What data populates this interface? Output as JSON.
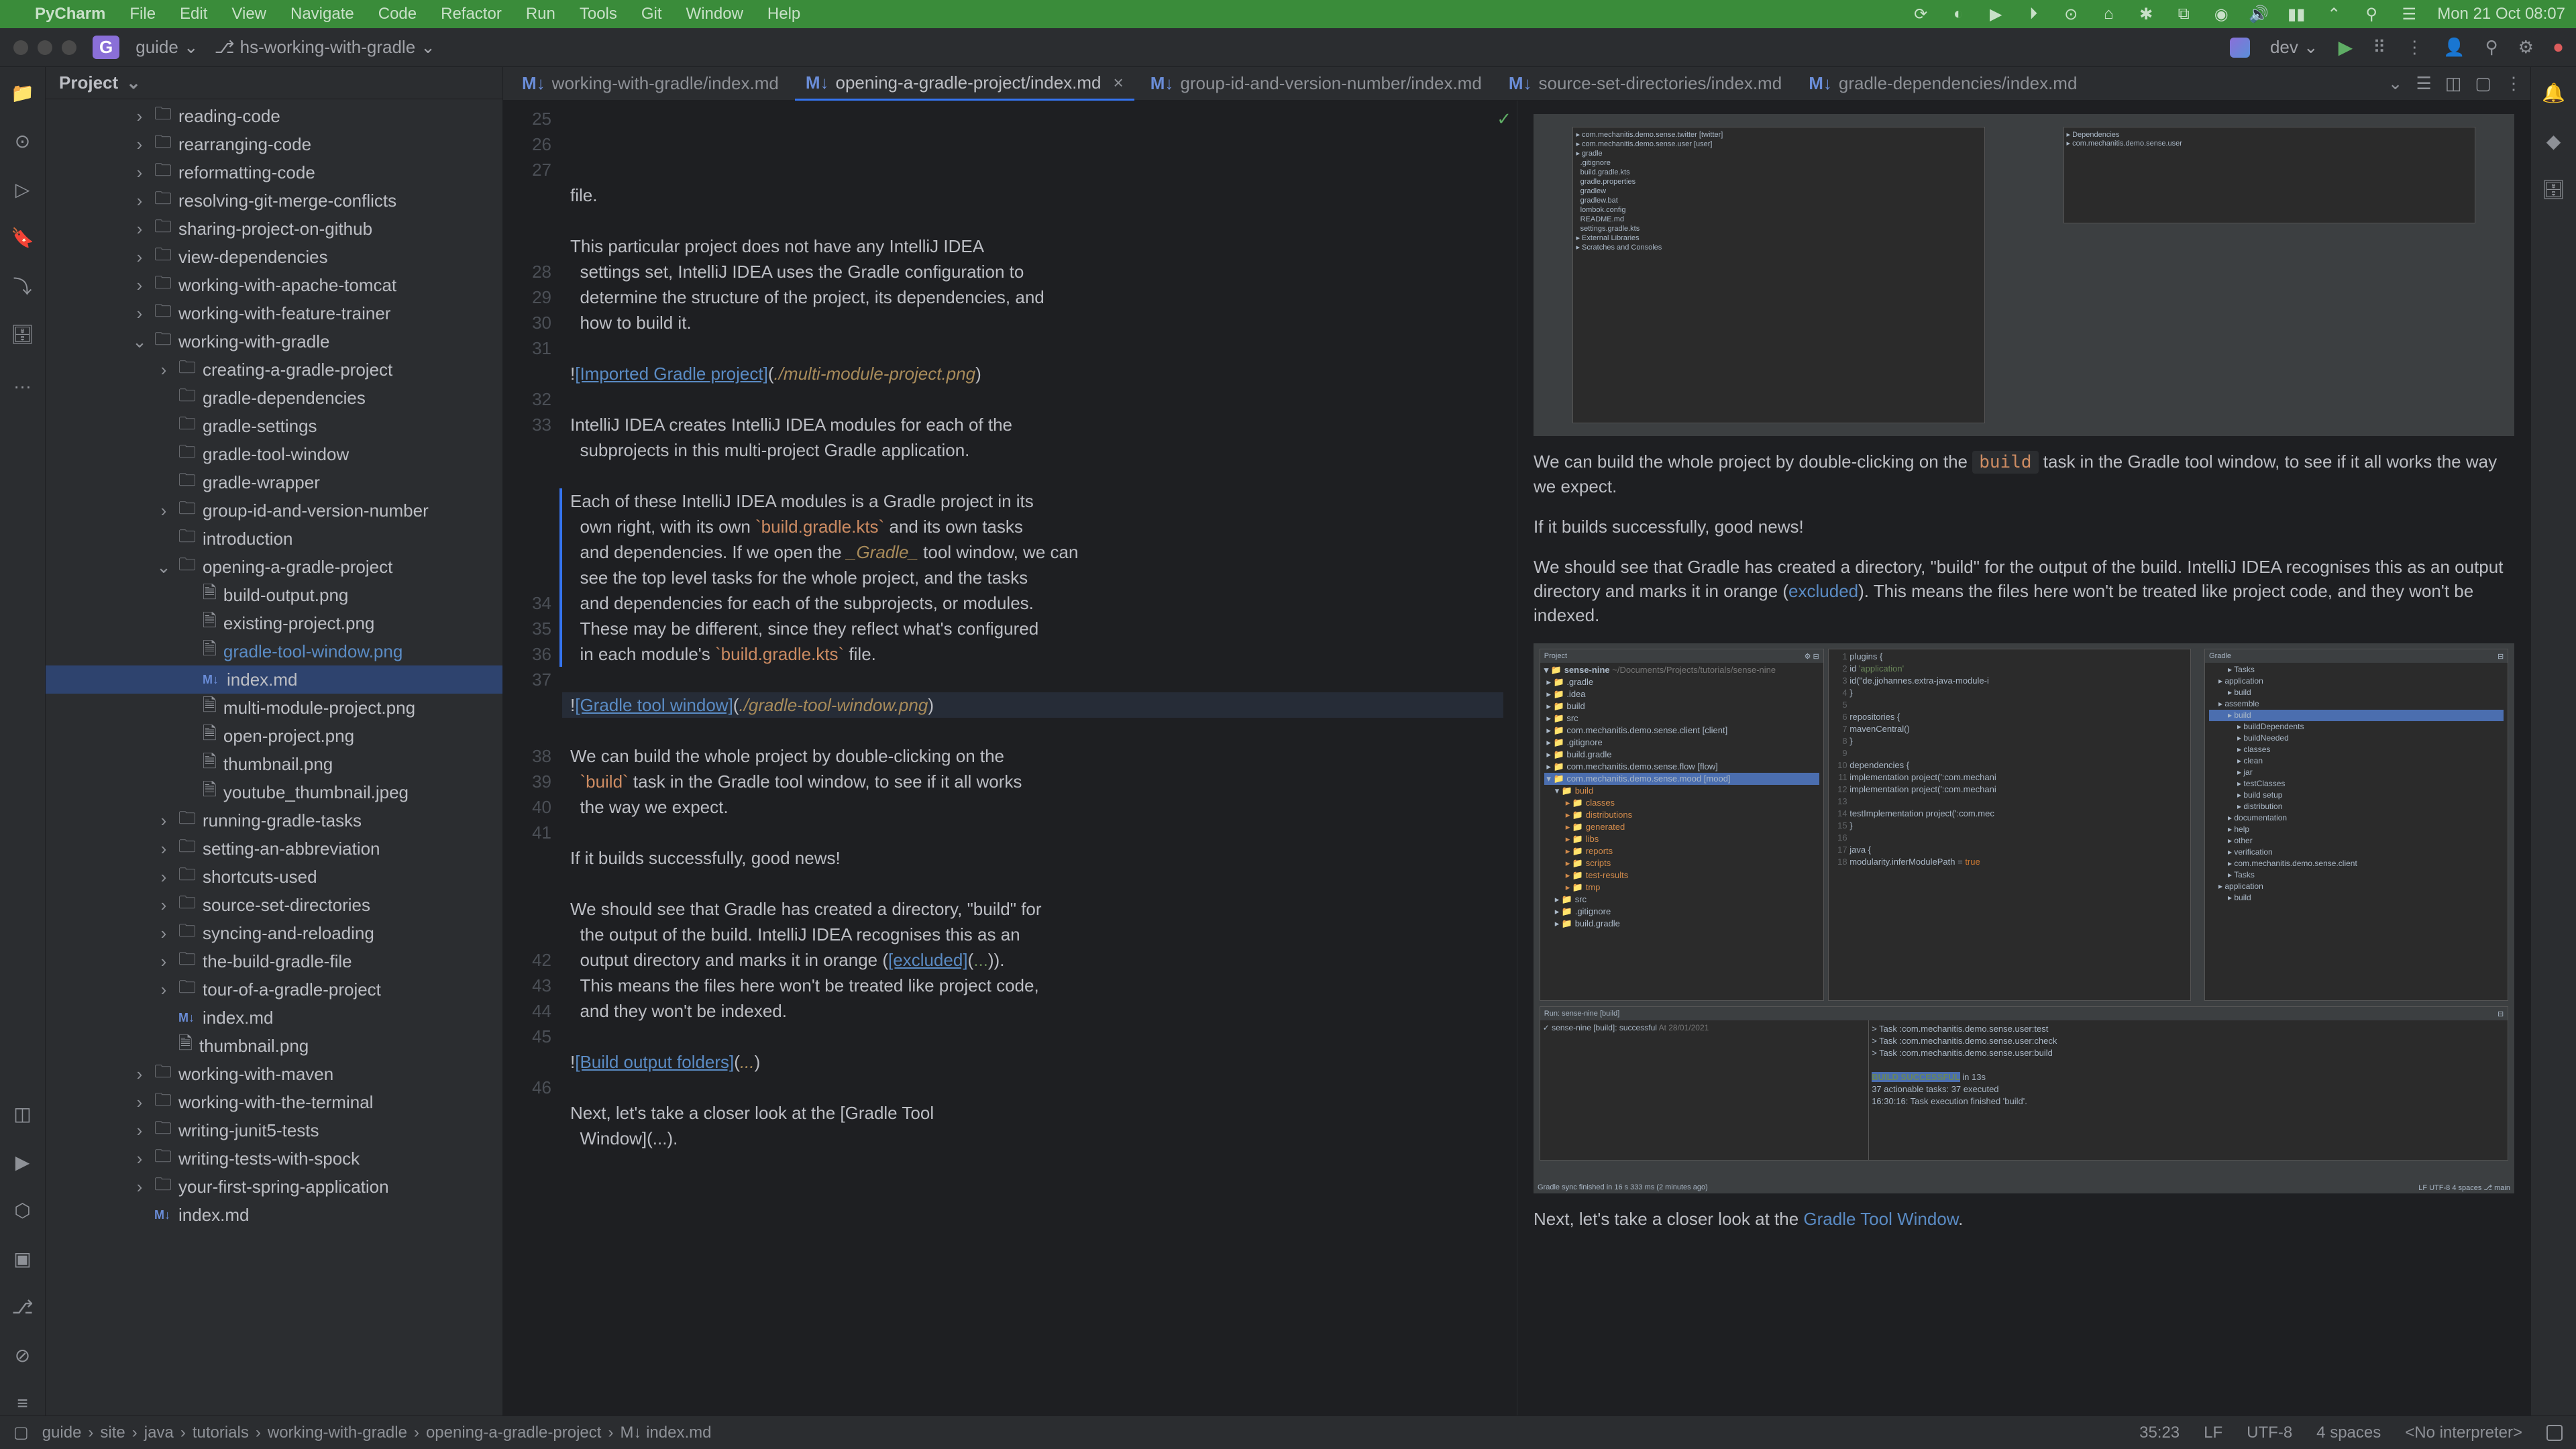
{
  "menubar": {
    "app": "PyCharm",
    "items": [
      "File",
      "Edit",
      "View",
      "Navigate",
      "Code",
      "Refactor",
      "Run",
      "Tools",
      "Git",
      "Window",
      "Help"
    ],
    "clock": "Mon 21 Oct 08:07"
  },
  "titlebar": {
    "project_badge": "G",
    "project_name": "guide",
    "branch_prefix": "⎇",
    "branch": "hs-working-with-gradle",
    "run_config": "dev"
  },
  "project_panel": {
    "title": "Project",
    "tree": [
      {
        "depth": 3,
        "arrow": ">",
        "icon": "folder",
        "label": "reading-code"
      },
      {
        "depth": 3,
        "arrow": ">",
        "icon": "folder",
        "label": "rearranging-code"
      },
      {
        "depth": 3,
        "arrow": ">",
        "icon": "folder",
        "label": "reformatting-code"
      },
      {
        "depth": 3,
        "arrow": ">",
        "icon": "folder",
        "label": "resolving-git-merge-conflicts"
      },
      {
        "depth": 3,
        "arrow": ">",
        "icon": "folder",
        "label": "sharing-project-on-github"
      },
      {
        "depth": 3,
        "arrow": ">",
        "icon": "folder",
        "label": "view-dependencies"
      },
      {
        "depth": 3,
        "arrow": ">",
        "icon": "folder",
        "label": "working-with-apache-tomcat"
      },
      {
        "depth": 3,
        "arrow": ">",
        "icon": "folder",
        "label": "working-with-feature-trainer"
      },
      {
        "depth": 3,
        "arrow": "v",
        "icon": "folder",
        "label": "working-with-gradle"
      },
      {
        "depth": 4,
        "arrow": ">",
        "icon": "folder",
        "label": "creating-a-gradle-project"
      },
      {
        "depth": 4,
        "arrow": "",
        "icon": "folder",
        "label": "gradle-dependencies"
      },
      {
        "depth": 4,
        "arrow": "",
        "icon": "folder",
        "label": "gradle-settings"
      },
      {
        "depth": 4,
        "arrow": "",
        "icon": "folder",
        "label": "gradle-tool-window"
      },
      {
        "depth": 4,
        "arrow": "",
        "icon": "folder",
        "label": "gradle-wrapper"
      },
      {
        "depth": 4,
        "arrow": ">",
        "icon": "folder",
        "label": "group-id-and-version-number"
      },
      {
        "depth": 4,
        "arrow": "",
        "icon": "folder",
        "label": "introduction"
      },
      {
        "depth": 4,
        "arrow": "v",
        "icon": "folder",
        "label": "opening-a-gradle-project"
      },
      {
        "depth": 5,
        "arrow": "",
        "icon": "file",
        "label": "build-output.png"
      },
      {
        "depth": 5,
        "arrow": "",
        "icon": "file",
        "label": "existing-project.png"
      },
      {
        "depth": 5,
        "arrow": "",
        "icon": "file",
        "label": "gradle-tool-window.png",
        "hl": true
      },
      {
        "depth": 5,
        "arrow": "",
        "icon": "md",
        "label": "index.md",
        "selected": true
      },
      {
        "depth": 5,
        "arrow": "",
        "icon": "file",
        "label": "multi-module-project.png"
      },
      {
        "depth": 5,
        "arrow": "",
        "icon": "file",
        "label": "open-project.png"
      },
      {
        "depth": 5,
        "arrow": "",
        "icon": "file",
        "label": "thumbnail.png"
      },
      {
        "depth": 5,
        "arrow": "",
        "icon": "file",
        "label": "youtube_thumbnail.jpeg"
      },
      {
        "depth": 4,
        "arrow": ">",
        "icon": "folder",
        "label": "running-gradle-tasks"
      },
      {
        "depth": 4,
        "arrow": ">",
        "icon": "folder",
        "label": "setting-an-abbreviation"
      },
      {
        "depth": 4,
        "arrow": ">",
        "icon": "folder",
        "label": "shortcuts-used"
      },
      {
        "depth": 4,
        "arrow": ">",
        "icon": "folder",
        "label": "source-set-directories"
      },
      {
        "depth": 4,
        "arrow": ">",
        "icon": "folder",
        "label": "syncing-and-reloading"
      },
      {
        "depth": 4,
        "arrow": ">",
        "icon": "folder",
        "label": "the-build-gradle-file"
      },
      {
        "depth": 4,
        "arrow": ">",
        "icon": "folder",
        "label": "tour-of-a-gradle-project"
      },
      {
        "depth": 4,
        "arrow": "",
        "icon": "md",
        "label": "index.md"
      },
      {
        "depth": 4,
        "arrow": "",
        "icon": "file",
        "label": "thumbnail.png"
      },
      {
        "depth": 3,
        "arrow": ">",
        "icon": "folder",
        "label": "working-with-maven"
      },
      {
        "depth": 3,
        "arrow": ">",
        "icon": "folder",
        "label": "working-with-the-terminal"
      },
      {
        "depth": 3,
        "arrow": ">",
        "icon": "folder",
        "label": "writing-junit5-tests"
      },
      {
        "depth": 3,
        "arrow": ">",
        "icon": "folder",
        "label": "writing-tests-with-spock"
      },
      {
        "depth": 3,
        "arrow": ">",
        "icon": "folder",
        "label": "your-first-spring-application"
      },
      {
        "depth": 3,
        "arrow": "",
        "icon": "md",
        "label": "index.md"
      }
    ]
  },
  "tabs": [
    {
      "label": "working-with-gradle/index.md",
      "active": false
    },
    {
      "label": "opening-a-gradle-project/index.md",
      "active": true
    },
    {
      "label": "group-id-and-version-number/index.md",
      "active": false
    },
    {
      "label": "source-set-directories/index.md",
      "active": false
    },
    {
      "label": "gradle-dependencies/index.md",
      "active": false
    }
  ],
  "editor": {
    "lines": [
      {
        "n": 25,
        "text": "  file."
      },
      {
        "n": 26,
        "text": ""
      },
      {
        "n": 27,
        "text": "This particular project does not have any IntelliJ IDEA settings set, IntelliJ IDEA uses the Gradle configuration to determine the structure of the project, its dependencies, and how to build it."
      },
      {
        "n": 28,
        "text": ""
      },
      {
        "n": 29,
        "text": "![Imported Gradle project](./multi-module-project.png)",
        "img": true
      },
      {
        "n": 30,
        "text": ""
      },
      {
        "n": 31,
        "text": "IntelliJ IDEA creates IntelliJ IDEA modules for each of the subprojects in this multi-project Gradle application."
      },
      {
        "n": 32,
        "text": ""
      },
      {
        "n": 33,
        "text": "Each of these IntelliJ IDEA modules is a Gradle project in its own right, with its own `build.gradle.kts` and its own tasks and dependencies. If we open the _Gradle_ tool window, we can see the top level tasks for the whole project, and the tasks and dependencies for each of the subprojects, or modules. These may be different, since they reflect what's configured in each module's `build.gradle.kts` file.",
        "blue": true
      },
      {
        "n": 34,
        "text": ""
      },
      {
        "n": 35,
        "text": "![Gradle tool window](./gradle-tool-window.png)",
        "img": true,
        "hl": true
      },
      {
        "n": 36,
        "text": ""
      },
      {
        "n": 37,
        "text": "We can build the whole project by double-clicking on the `build` task in the Gradle tool window, to see if it all works the way we expect."
      },
      {
        "n": 38,
        "text": ""
      },
      {
        "n": 39,
        "text": "If it builds successfully, good news!"
      },
      {
        "n": 40,
        "text": ""
      },
      {
        "n": 41,
        "text": "We should see that Gradle has created a directory, \"build\" for the output of the build. IntelliJ IDEA recognises this as an output directory and marks it in orange ([excluded](...)). This means the files here won't be treated like project code, and they won't be indexed."
      },
      {
        "n": 42,
        "text": ""
      },
      {
        "n": 43,
        "text": "![Build output folders](...)",
        "img": true
      },
      {
        "n": 44,
        "text": ""
      },
      {
        "n": 45,
        "text": "Next, let's take a closer look at the [Gradle Tool Window](...)."
      },
      {
        "n": 46,
        "text": ""
      }
    ]
  },
  "preview": {
    "p1_a": "We can build the whole project by double-clicking on the ",
    "p1_code": "build",
    "p1_b": " task in the Gradle tool window, to see if it all works the way we expect.",
    "p2": "If it builds successfully, good news!",
    "p3_a": "We should see that Gradle has created a directory, \"build\" for the output of the build. IntelliJ IDEA recognises this as an output directory and marks it in orange (",
    "p3_link": "excluded",
    "p3_b": "). This means the files here won't be treated like project code, and they won't be indexed.",
    "p4_a": "Next, let's take a closer look at the ",
    "p4_link": "Gradle Tool Window",
    "p4_b": "."
  },
  "preview_img2": {
    "project_header": "Project",
    "tree_root": "sense-nine",
    "tree_root_path": "~/Documents/Projects/tutorials/sense-nine",
    "tree": [
      ".gradle",
      ".idea",
      "build",
      "src",
      "com.mechanitis.demo.sense.client [client]",
      ".gitignore",
      "build.gradle",
      "com.mechanitis.demo.sense.flow [flow]",
      "com.mechanitis.demo.sense.mood [mood]"
    ],
    "build_children": [
      "classes",
      "distributions",
      "generated",
      "libs",
      "reports",
      "scripts",
      "test-results",
      "tmp"
    ],
    "tree_tail": [
      "src",
      ".gitignore",
      "build.gradle"
    ],
    "code_lines": [
      {
        "n": 1,
        "t": "plugins {"
      },
      {
        "n": 2,
        "t": "    id 'application'"
      },
      {
        "n": 3,
        "t": "    id(\"de.jjohannes.extra-java-module-i"
      },
      {
        "n": 4,
        "t": "}"
      },
      {
        "n": 5,
        "t": ""
      },
      {
        "n": 6,
        "t": "repositories {"
      },
      {
        "n": 7,
        "t": "    mavenCentral()"
      },
      {
        "n": 8,
        "t": "}"
      },
      {
        "n": 9,
        "t": ""
      },
      {
        "n": 10,
        "t": "dependencies {"
      },
      {
        "n": 11,
        "t": "    implementation project(':com.mechani"
      },
      {
        "n": 12,
        "t": "    implementation project(':com.mechani"
      },
      {
        "n": 13,
        "t": ""
      },
      {
        "n": 14,
        "t": "    testImplementation project(':com.mec"
      },
      {
        "n": 15,
        "t": "}"
      },
      {
        "n": 16,
        "t": ""
      },
      {
        "n": 17,
        "t": "java {"
      },
      {
        "n": 18,
        "t": "    modularity.inferModulePath = true"
      }
    ],
    "gradle_header": "Gradle",
    "gradle_tree": [
      "Tasks",
      "application",
      "build",
      "assemble",
      "build",
      "buildDependents",
      "buildNeeded",
      "classes",
      "clean",
      "jar",
      "testClasses",
      "build setup",
      "distribution",
      "documentation",
      "help",
      "other",
      "verification",
      "com.mechanitis.demo.sense.client",
      "Tasks",
      "application",
      "build"
    ],
    "run_header": "Run:",
    "run_title": "sense-nine [build]",
    "run_status": "sense-nine [build]: successful",
    "run_time": "At 28/01/2021",
    "run_output": [
      "> Task :com.mechanitis.demo.sense.user:test",
      "> Task :com.mechanitis.demo.sense.user:check",
      "> Task :com.mechanitis.demo.sense.user:build",
      "",
      "BUILD SUCCESSFUL in 13s",
      "37 actionable tasks: 37 executed",
      "16:30:16: Task execution finished 'build'."
    ],
    "bottom_status_left": "Gradle sync finished in 16 s 333 ms (2 minutes ago)",
    "bottom_status_right": "LF  UTF-8  4 spaces  ⎇ main"
  },
  "breadcrumb": [
    "guide",
    "site",
    "java",
    "tutorials",
    "working-with-gradle",
    "opening-a-gradle-project",
    "M↓ index.md"
  ],
  "statusbar": {
    "pos": "35:23",
    "line_sep": "LF",
    "encoding": "UTF-8",
    "indent": "4 spaces",
    "interpreter": "<No interpreter>"
  }
}
